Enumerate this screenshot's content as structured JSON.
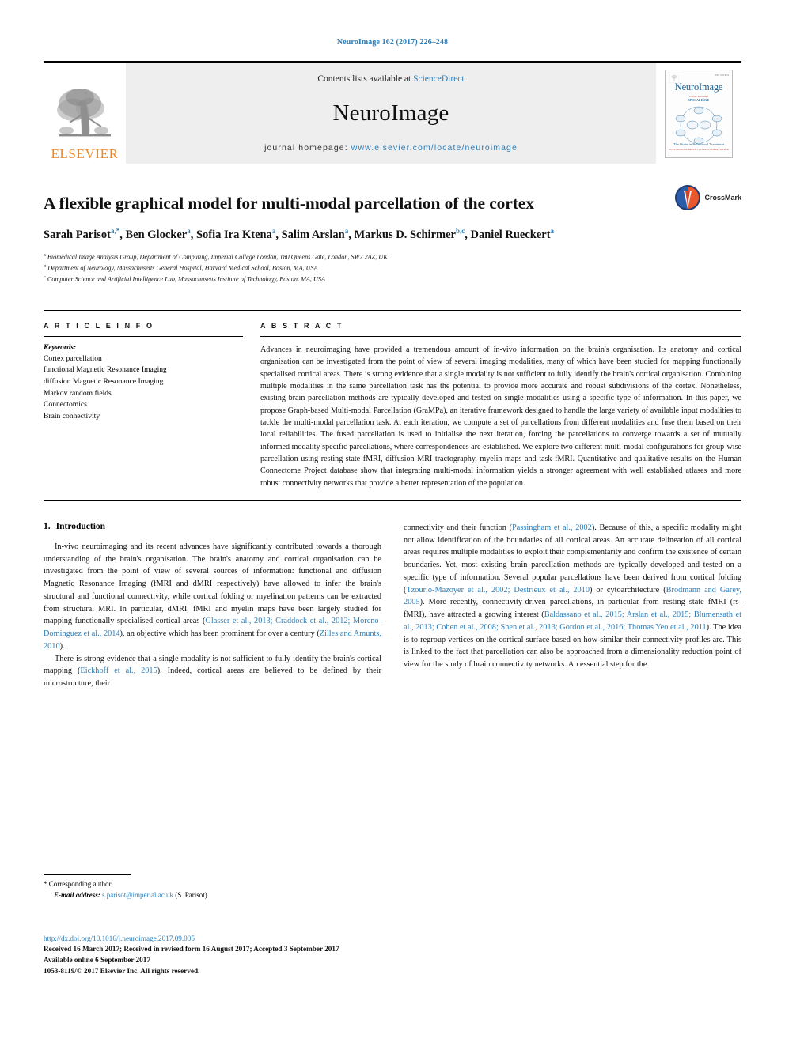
{
  "running_head": "NeuroImage 162 (2017) 226–248",
  "masthead": {
    "contents_prefix": "Contents lists available at ",
    "sciencedirect": "ScienceDirect",
    "journal_name": "NeuroImage",
    "homepage_label": "journal homepage: ",
    "homepage_url": "www.elsevier.com/locate/neuroimage",
    "publisher": "ELSEVIER",
    "cover": {
      "title": "NeuroImage",
      "sub": "Editor-in-Chief",
      "sub2": "SPECIAL ISSUE",
      "foot": "The Brain in Behavioral Treatment",
      "foot2": "GUEST EDITORS: BRUCE CUTHBERT, ROBERT BILDER",
      "issn": "ISSN 1053-8119"
    }
  },
  "article": {
    "title": "A flexible graphical model for multi-modal parcellation of the cortex",
    "crossmark_label": "CrossMark",
    "authors_html": "Sarah Parisot<sup>a,*</sup>, Ben Glocker<sup>a</sup>, Sofia Ira Ktena<sup>a</sup>, Salim Arslan<sup>a</sup>, Markus D. Schirmer<sup>b,c</sup>, Daniel Rueckert<sup>a</sup>",
    "affiliations": [
      "<sup>a</sup> Biomedical Image Analysis Group, Department of Computing, Imperial College London, 180 Queens Gate, London, SW7 2AZ, UK",
      "<sup>b</sup> Department of Neurology, Massachusetts General Hospital, Harvard Medical School, Boston, MA, USA",
      "<sup>c</sup> Computer Science and Artificial Intelligence Lab, Massachusetts Institute of Technology, Boston, MA, USA"
    ]
  },
  "article_info": {
    "heading": "A R T I C L E  I N F O",
    "keywords_label": "Keywords:",
    "keywords": [
      "Cortex parcellation",
      "functional Magnetic Resonance Imaging",
      "diffusion Magnetic Resonance Imaging",
      "Markov random fields",
      "Connectomics",
      "Brain connectivity"
    ]
  },
  "abstract": {
    "heading": "A B S T R A C T",
    "text": "Advances in neuroimaging have provided a tremendous amount of in-vivo information on the brain's organisation. Its anatomy and cortical organisation can be investigated from the point of view of several imaging modalities, many of which have been studied for mapping functionally specialised cortical areas. There is strong evidence that a single modality is not sufficient to fully identify the brain's cortical organisation. Combining multiple modalities in the same parcellation task has the potential to provide more accurate and robust subdivisions of the cortex. Nonetheless, existing brain parcellation methods are typically developed and tested on single modalities using a specific type of information. In this paper, we propose Graph-based Multi-modal Parcellation (GraMPa), an iterative framework designed to handle the large variety of available input modalities to tackle the multi-modal parcellation task. At each iteration, we compute a set of parcellations from different modalities and fuse them based on their local reliabilities. The fused parcellation is used to initialise the next iteration, forcing the parcellations to converge towards a set of mutually informed modality specific parcellations, where correspondences are established. We explore two different multi-modal configurations for group-wise parcellation using resting-state fMRI, diffusion MRI tractography, myelin maps and task fMRI. Quantitative and qualitative results on the Human Connectome Project database show that integrating multi-modal information yields a stronger agreement with well established atlases and more robust connectivity networks that provide a better representation of the population."
  },
  "body": {
    "section_number": "1.",
    "section_title": "Introduction",
    "left_paragraphs_html": [
      "In-vivo neuroimaging and its recent advances have significantly contributed towards a thorough understanding of the brain's organisation. The brain's anatomy and cortical organisation can be investigated from the point of view of several sources of information: functional and diffusion Magnetic Resonance Imaging (fMRI and dMRI respectively) have allowed to infer the brain's structural and functional connectivity, while cortical folding or myelination patterns can be extracted from structural MRI. In particular, dMRI, fMRI and myelin maps have been largely studied for mapping functionally specialised cortical areas (<span class=\"cite\">Glasser et al., 2013; Craddock et al., 2012; Moreno-Dominguez et al., 2014</span>), an objective which has been prominent for over a century (<span class=\"cite\">Zilles and Amunts, 2010</span>).",
      "There is strong evidence that a single modality is not sufficient to fully identify the brain's cortical mapping (<span class=\"cite\">Eickhoff et al., 2015</span>). Indeed, cortical areas are believed to be defined by their microstructure, their"
    ],
    "right_paragraphs_html": [
      "connectivity and their function (<span class=\"cite\">Passingham et al., 2002</span>). Because of this, a specific modality might not allow identification of the boundaries of all cortical areas. An accurate delineation of all cortical areas requires multiple modalities to exploit their complementarity and confirm the existence of certain boundaries. Yet, most existing brain parcellation methods are typically developed and tested on a specific type of information. Several popular parcellations have been derived from cortical folding (<span class=\"cite\">Tzourio-Mazoyer et al., 2002; Destrieux et al., 2010</span>) or cytoarchitecture (<span class=\"cite\">Brodmann and Garey, 2005</span>). More recently, connectivity-driven parcellations, in particular from resting state fMRI (rs-fMRI), have attracted a growing interest (<span class=\"cite\">Baldassano et al., 2015; Arslan et al., 2015; Blumensath et al., 2013; Cohen et al., 2008; Shen et al., 2013; Gordon et al., 2016; Thomas Yeo et al., 2011</span>). The idea is to regroup vertices on the cortical surface based on how similar their connectivity profiles are. This is linked to the fact that parcellation can also be approached from a dimensionality reduction point of view for the study of brain connectivity networks. An essential step for the"
    ]
  },
  "footnote": {
    "corresponding": "* Corresponding author.",
    "email_label": "E-mail address:",
    "email": "s.parisot@imperial.ac.uk",
    "email_suffix": "(S. Parisot)."
  },
  "footer": {
    "doi": "http://dx.doi.org/10.1016/j.neuroimage.2017.09.005",
    "received": "Received 16 March 2017; Received in revised form 16 August 2017; Accepted 3 September 2017",
    "available": "Available online 6 September 2017",
    "copyright": "1053-8119/© 2017 Elsevier Inc. All rights reserved."
  },
  "colors": {
    "link": "#2e7eb8",
    "elsevier_orange": "#F18720",
    "masthead_bg": "#eeeeee"
  }
}
